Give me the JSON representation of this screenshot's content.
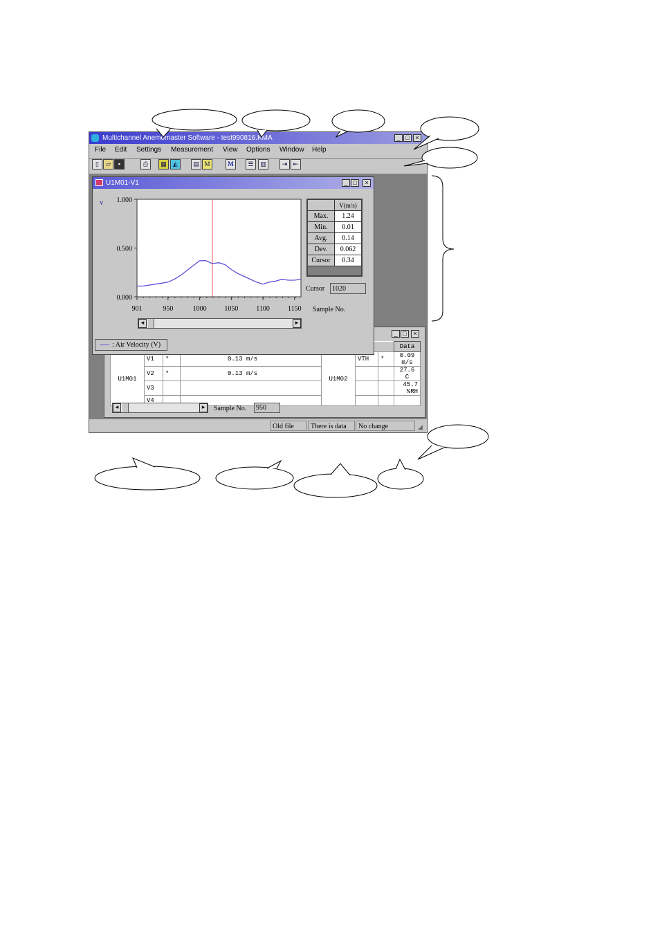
{
  "window": {
    "title": "Multichannel Anemomaster Software - test990816.KMA",
    "buttons": [
      "_",
      "□",
      "×"
    ]
  },
  "menu": [
    "File",
    "Edit",
    "Settings",
    "Measurement",
    "View",
    "Options",
    "Window",
    "Help"
  ],
  "toolbar_icons": [
    "new-file-icon",
    "open-folder-icon",
    "save-icon",
    "print-icon",
    "graph-icon",
    "chart-icon",
    "settings-icon",
    "measure-icon",
    "m-icon",
    "list-icon",
    "table-icon",
    "export-icon",
    "import-icon"
  ],
  "graph_window": {
    "title": "U1M01-V1",
    "y_symbol": "v",
    "cursor_label": "Cursor",
    "cursor_value": "1020",
    "x_axis_label": "Sample No.",
    "legend": ": Air Velocity (V)",
    "stats": {
      "header": "V(m/s)",
      "rows": [
        {
          "label": "Max.",
          "value": "1.24"
        },
        {
          "label": "Min.",
          "value": "0.01"
        },
        {
          "label": "Avg.",
          "value": "0.14"
        },
        {
          "label": "Dev.",
          "value": "0.062"
        },
        {
          "label": "Cursor",
          "value": "0.34"
        }
      ]
    }
  },
  "chart_data": {
    "type": "line",
    "x_ticks": [
      "901",
      "950",
      "1000",
      "1050",
      "1100",
      "1150"
    ],
    "y_ticks": [
      "1.000",
      "0.500",
      "0.000"
    ],
    "xlim": [
      901,
      1160
    ],
    "ylim": [
      0,
      1
    ],
    "cursor_x": 1020,
    "series": [
      {
        "color": "#5a4fd8",
        "x": [
          901,
          910,
          920,
          930,
          940,
          950,
          960,
          970,
          980,
          990,
          1000,
          1010,
          1020,
          1030,
          1040,
          1050,
          1060,
          1070,
          1080,
          1090,
          1100,
          1110,
          1120,
          1130,
          1140,
          1150,
          1160
        ],
        "values": [
          0.11,
          0.11,
          0.12,
          0.13,
          0.14,
          0.15,
          0.18,
          0.22,
          0.27,
          0.32,
          0.37,
          0.37,
          0.34,
          0.35,
          0.33,
          0.28,
          0.24,
          0.21,
          0.18,
          0.15,
          0.13,
          0.15,
          0.16,
          0.18,
          0.17,
          0.17,
          0.18
        ]
      }
    ]
  },
  "data_window": {
    "header": "Data",
    "left_group": "U1M01",
    "left_rows": [
      {
        "ch": "V1",
        "mark": "*",
        "value": "0.13 m/s"
      },
      {
        "ch": "V2",
        "mark": "*",
        "value": "0.13 m/s"
      },
      {
        "ch": "V3",
        "mark": "",
        "value": ""
      },
      {
        "ch": "V4",
        "mark": "",
        "value": ""
      }
    ],
    "right_group": "U1M02",
    "right_rows": [
      {
        "ch": "VTH",
        "mark": "*",
        "value": "0.09 m/s"
      },
      {
        "ch": "",
        "mark": "",
        "value": "27.6 C"
      },
      {
        "ch": "",
        "mark": "",
        "value": "45.7 %RH"
      },
      {
        "ch": "",
        "mark": "",
        "value": ""
      }
    ],
    "sample_label": "Sample No.",
    "sample_value": "950"
  },
  "statusbar": [
    "Old file",
    "There is data",
    "No change"
  ]
}
